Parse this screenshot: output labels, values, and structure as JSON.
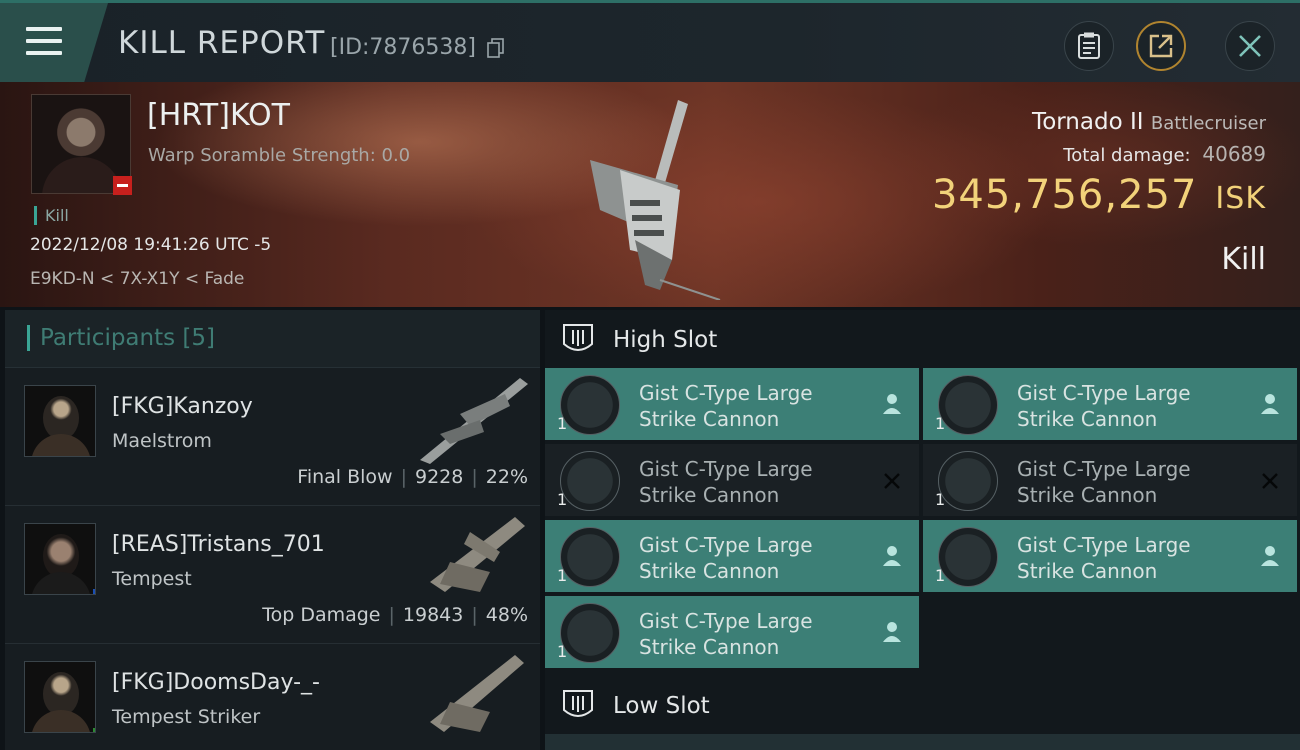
{
  "header": {
    "title": "KILL REPORT",
    "id_text": "[ID:7876538]"
  },
  "victim": {
    "name": "[HRT]KOT",
    "subtitle": "Warp Soramble Strength: 0.0",
    "tag": "Kill",
    "datetime": "2022/12/08 19:41:26 UTC -5",
    "location": "E9KD-N < 7X-X1Y < Fade",
    "ship": "Tornado II",
    "ship_class": "Battlecruiser",
    "total_damage_label": "Total damage:",
    "total_damage": "40689",
    "isk_value": "345,756,257",
    "isk_unit": "ISK",
    "result": "Kill"
  },
  "participants": {
    "header": "Participants [5]",
    "rows": [
      {
        "name": "[FKG]Kanzoy",
        "ship": "Maelstrom",
        "role": "Final Blow",
        "damage": "9228",
        "percent": "22%"
      },
      {
        "name": "[REAS]Tristans_701",
        "ship": "Tempest",
        "role": "Top Damage",
        "damage": "19843",
        "percent": "48%"
      },
      {
        "name": "[FKG]DoomsDay-_-",
        "ship": "Tempest Striker"
      }
    ]
  },
  "slots": {
    "high_label": "High Slot",
    "low_label": "Low Slot",
    "items": [
      {
        "name": "Gist C-Type Large Strike Cannon",
        "qty": "1",
        "state": "pilot"
      },
      {
        "name": "Gist C-Type Large Strike Cannon",
        "qty": "1",
        "state": "pilot"
      },
      {
        "name": "Gist C-Type Large Strike Cannon",
        "qty": "1",
        "state": "destroyed"
      },
      {
        "name": "Gist C-Type Large Strike Cannon",
        "qty": "1",
        "state": "destroyed"
      },
      {
        "name": "Gist C-Type Large Strike Cannon",
        "qty": "1",
        "state": "pilot"
      },
      {
        "name": "Gist C-Type Large Strike Cannon",
        "qty": "1",
        "state": "pilot"
      },
      {
        "name": "Gist C-Type Large Strike Cannon",
        "qty": "1",
        "state": "pilot"
      }
    ]
  },
  "colors": {
    "accent": "#3aa595",
    "slot_active": "#3c7f76",
    "isk": "#f2d27a",
    "loss_badge": "#c7201d"
  },
  "icons": [
    "menu-icon",
    "copy-icon",
    "clipboard-icon",
    "share-icon",
    "close-icon",
    "slot-icon",
    "pilot-icon",
    "destroyed-x-icon"
  ]
}
